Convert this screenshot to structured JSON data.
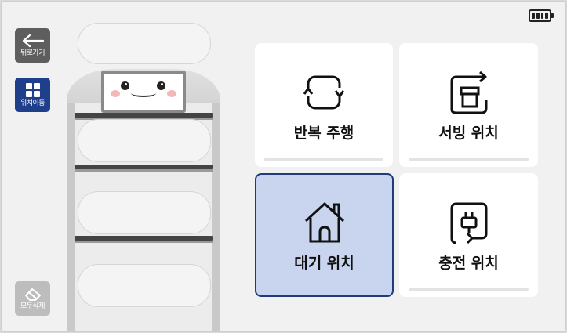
{
  "sidebar": {
    "back_label": "뒤로가기",
    "move_label": "위치이동",
    "clear_label": "모두삭제"
  },
  "actions": [
    {
      "label": "반복 주행",
      "icon": "repeat-loop-icon",
      "selected": false
    },
    {
      "label": "서빙 위치",
      "icon": "serving-box-icon",
      "selected": false
    },
    {
      "label": "대기 위치",
      "icon": "home-icon",
      "selected": true
    },
    {
      "label": "충전 위치",
      "icon": "charging-plug-icon",
      "selected": false
    }
  ],
  "status": {
    "battery_icon": "battery-full-icon"
  },
  "colors": {
    "accent": "#1f3f8a",
    "selected_bg": "#c9d5ee",
    "selected_border": "#1f3d7a"
  }
}
